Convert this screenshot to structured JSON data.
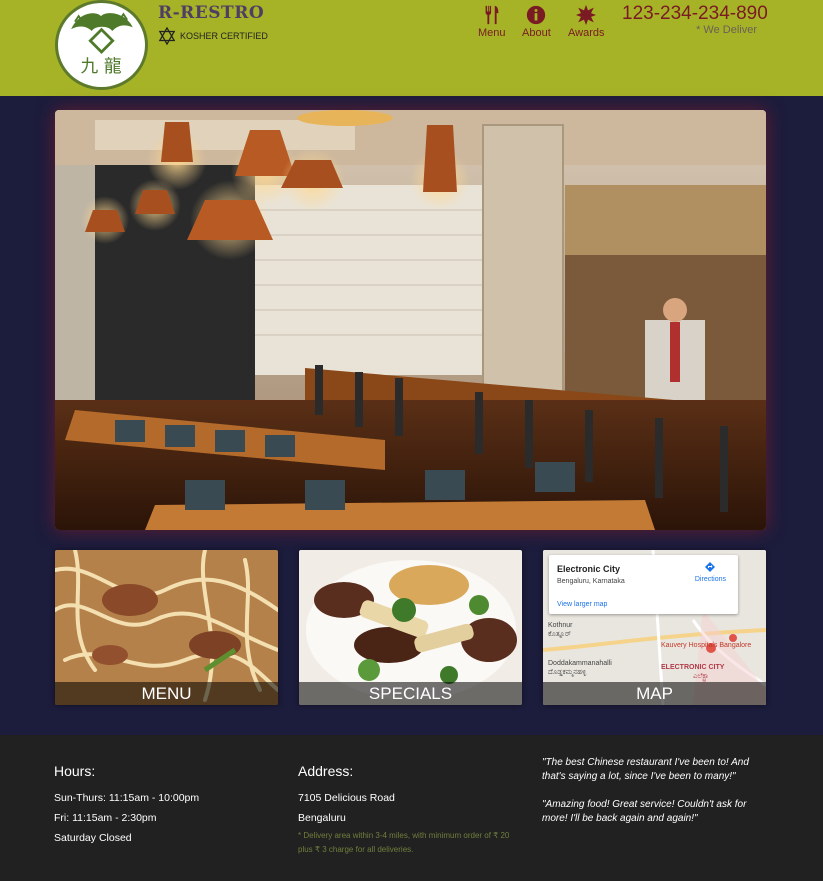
{
  "header": {
    "brand_name": "R-RESTRO",
    "kosher_label": "KOSHER CERTIFIED",
    "logo_glyphs": "九 龍",
    "nav": [
      {
        "label": "Menu",
        "icon": "utensils-icon"
      },
      {
        "label": "About",
        "icon": "info-icon"
      },
      {
        "label": "Awards",
        "icon": "award-icon"
      }
    ],
    "phone": "123-234-234-890",
    "delivery_note": "* We Deliver"
  },
  "hero": {
    "image": "restaurant-interior-photo"
  },
  "tiles": {
    "menu_label": "MENU",
    "specials_label": "SPECIALS",
    "map_label": "MAP"
  },
  "map": {
    "place": "Electronic City",
    "region": "Bengaluru, Karnataka",
    "directions_label": "Directions",
    "larger_map_link": "View larger map",
    "labels": {
      "kothnur": "Kothnur",
      "kothnur_kn": "ಕೊತ್ನೂರ್",
      "hospital": "Kauvery Hospitals Bangalore",
      "doddakammanahalli": "Doddakammanahalli",
      "doddakammanahalli_kn": "ದೊಡ್ಡಕಮ್ಮನಹಳ್ಳಿ",
      "electronic_city": "ELECTRONIC CITY",
      "electronic_city_kn": "ಎಲೆಕ್ಟ್ರಾ"
    }
  },
  "footer": {
    "hours_title": "Hours:",
    "hours": [
      "Sun-Thurs: 11:15am - 10:00pm",
      "Fri: 11:15am - 2:30pm",
      "Saturday Closed"
    ],
    "address_title": "Address:",
    "address": [
      "7105 Delicious Road",
      "Bengaluru"
    ],
    "delivery_note": "* Delivery area within 3-4 miles, with minimum order of ₹ 20 plus ₹ 3 charge for all deliveries.",
    "quotes": [
      "\"The best Chinese restaurant I've been to! And that's saying a lot, since I've been to many!\"",
      "\"Amazing food! Great service! Couldn't ask for more! I'll be back again and again!\""
    ]
  },
  "colors": {
    "header_bg": "#a6b327",
    "page_bg": "#1c1c3c",
    "accent": "#7a1b23",
    "footer_bg": "#212121",
    "note_green": "#6f7f3c"
  }
}
